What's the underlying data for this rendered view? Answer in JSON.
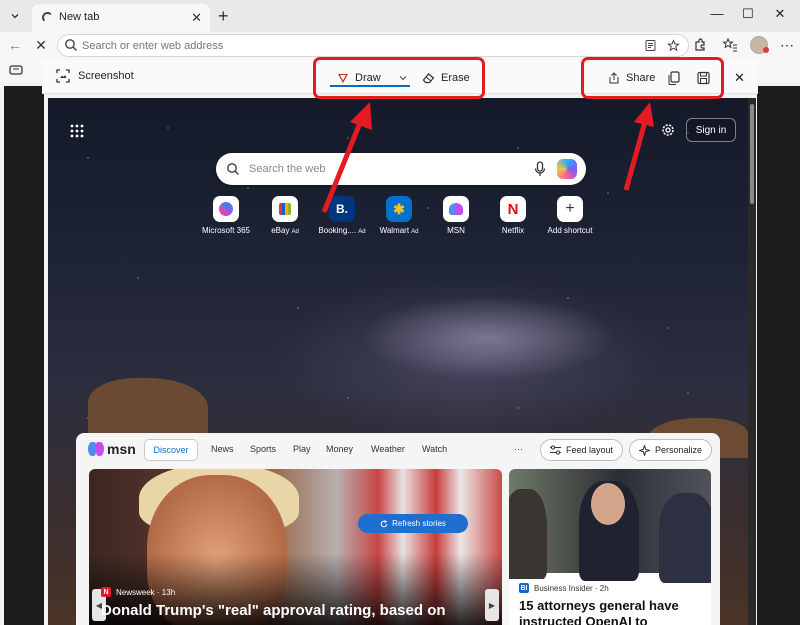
{
  "browser": {
    "tab_title": "New tab",
    "omnibox_placeholder": "Search or enter web address"
  },
  "capture": {
    "label": "Screenshot",
    "draw_label": "Draw",
    "erase_label": "Erase",
    "share_label": "Share",
    "accent": "#0f6cbd",
    "highlight_color": "#e31b23"
  },
  "ntp": {
    "signin_label": "Sign in",
    "search_placeholder": "Search the web",
    "shortcuts": [
      {
        "label": "Microsoft 365",
        "ad": "",
        "icon": "microsoft-365-icon"
      },
      {
        "label": "eBay",
        "ad": "Ad",
        "icon": "ebay-icon"
      },
      {
        "label": "Booking....",
        "ad": "Ad",
        "icon": "booking-icon"
      },
      {
        "label": "Walmart",
        "ad": "Ad",
        "icon": "walmart-icon"
      },
      {
        "label": "MSN",
        "ad": "",
        "icon": "msn-icon"
      },
      {
        "label": "Netflix",
        "ad": "",
        "icon": "netflix-icon"
      },
      {
        "label": "Add shortcut",
        "ad": "",
        "icon": "plus-icon"
      }
    ]
  },
  "msn": {
    "logo_text": "msn",
    "discover": "Discover",
    "nav": [
      "News",
      "Sports",
      "Play",
      "Money",
      "Weather",
      "Watch"
    ],
    "more": "···",
    "feed_layout": "Feed layout",
    "personalize": "Personalize",
    "refresh": "Refresh stories",
    "hero": {
      "source": "Newsweek · 13h",
      "title": "Donald Trump's \"real\" approval rating, based on"
    },
    "side": {
      "source": "Business Insider · 2h",
      "title": "15 attorneys general have instructed OpenAI to"
    }
  }
}
